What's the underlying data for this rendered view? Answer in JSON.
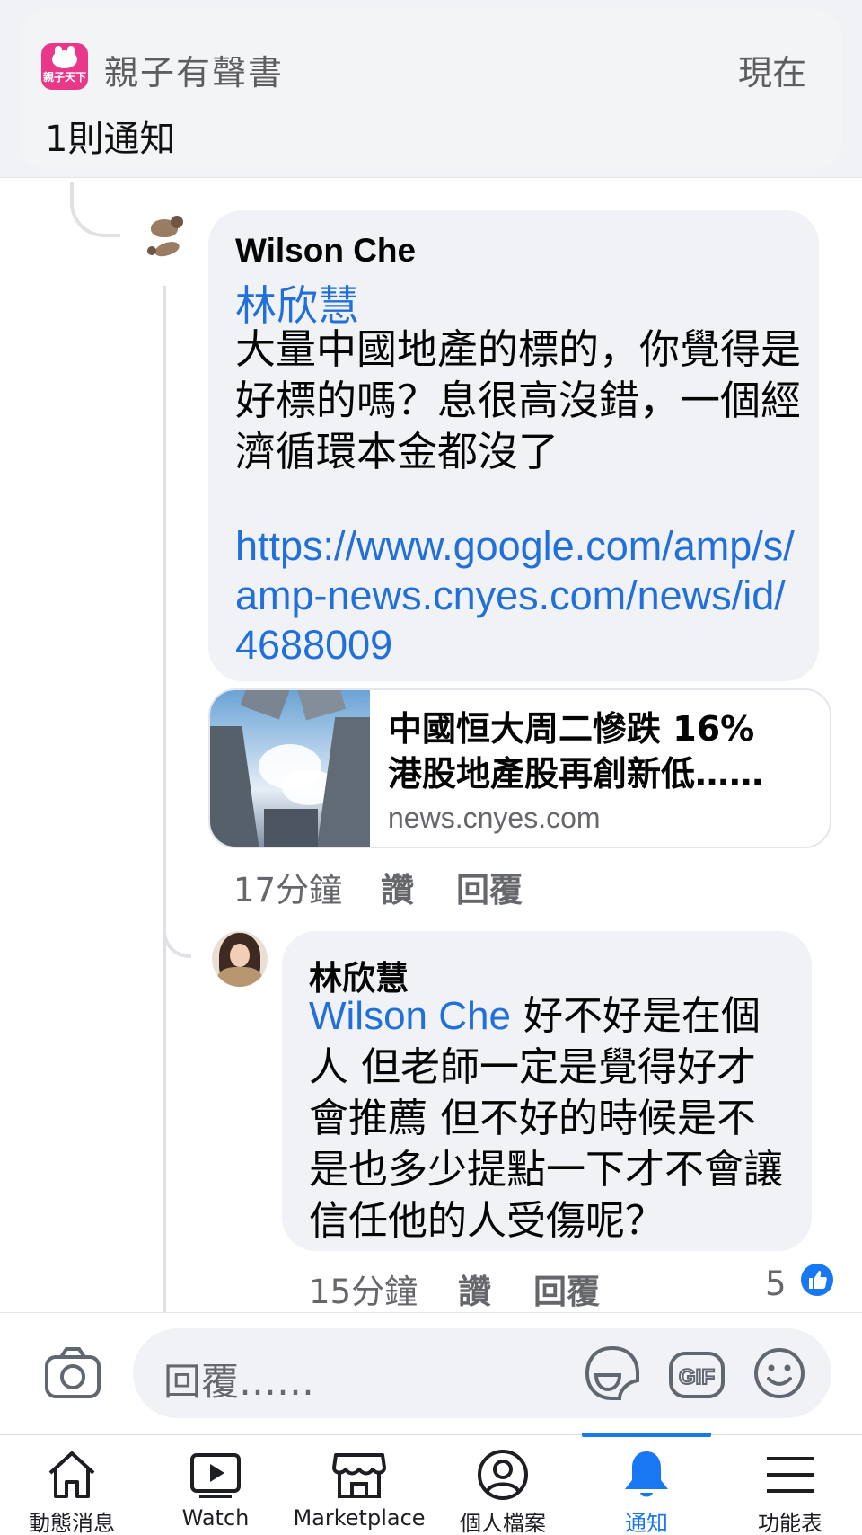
{
  "notification": {
    "app_name": "親子有聲書",
    "app_icon_text": "親子天下",
    "time": "現在",
    "summary": "1則通知"
  },
  "comments": [
    {
      "author": "Wilson Che",
      "mention": "林欣慧",
      "body": "大量中國地產的標的，你覺得是好標的嗎？息很高沒錯，一個經濟循環本金都沒了",
      "link": "https://www.google.com/amp/s/amp-news.cnyes.com/news/id/4688009",
      "preview": {
        "title_line1": "中國恒大周二慘跌 16%",
        "title_line2": "港股地產股再創新低……",
        "domain": "news.cnyes.com"
      },
      "time": "17分鐘",
      "like_label": "讚",
      "reply_label": "回覆"
    },
    {
      "author": "林欣慧",
      "mention": "Wilson Che",
      "body": " 好不好是在個人 但老師一定是覺得好才會推薦 但不好的時候是不是也多少提點一下才不會讓信任他的人受傷呢？",
      "time": "15分鐘",
      "like_label": "讚",
      "reply_label": "回覆",
      "reaction_count": "5"
    }
  ],
  "reply_box": {
    "placeholder": "回覆……",
    "icons": [
      "camera-icon",
      "sticker-icon",
      "gif-icon",
      "emoji-icon"
    ]
  },
  "tabs": [
    {
      "label": "動態消息",
      "icon": "home-icon"
    },
    {
      "label": "Watch",
      "icon": "watch-icon"
    },
    {
      "label": "Marketplace",
      "icon": "marketplace-icon"
    },
    {
      "label": "個人檔案",
      "icon": "profile-icon"
    },
    {
      "label": "通知",
      "icon": "bell-icon",
      "active": true
    },
    {
      "label": "功能表",
      "icon": "menu-icon"
    }
  ],
  "colors": {
    "accent": "#1877f2",
    "mention": "#216fdb",
    "bubble": "#f0f2f5",
    "app_icon": "#e8388a"
  }
}
